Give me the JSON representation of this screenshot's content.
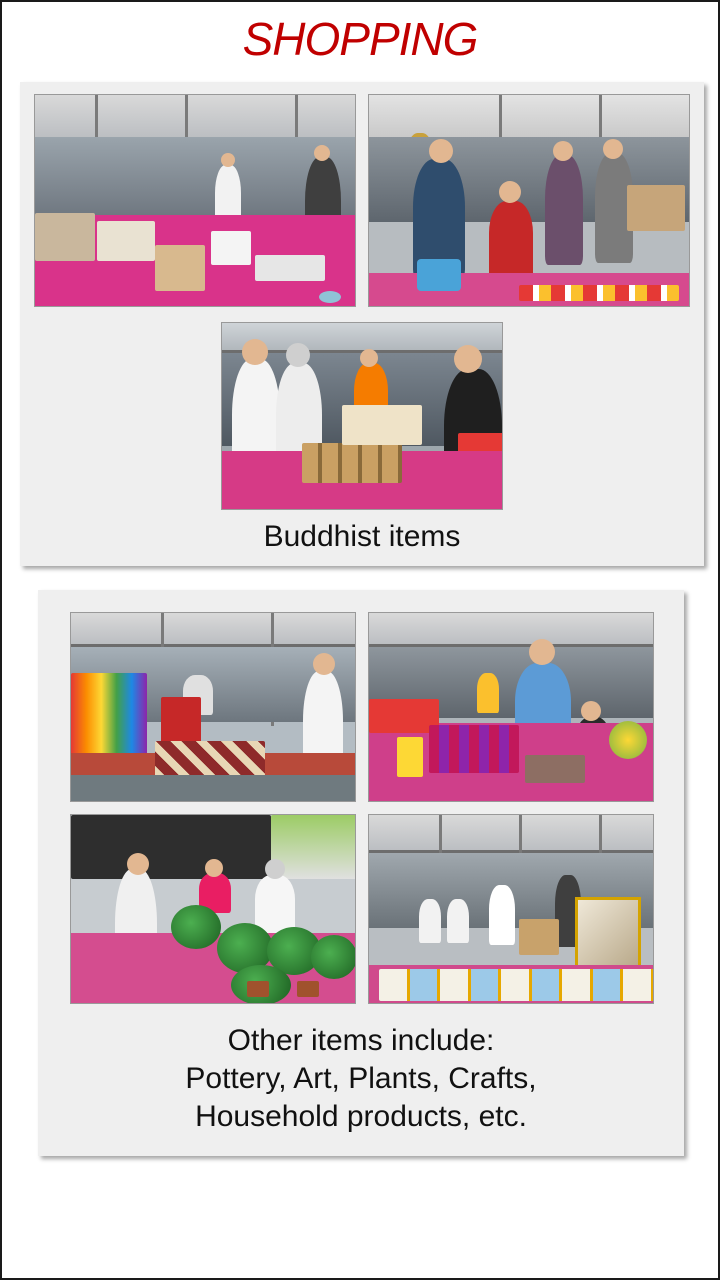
{
  "page": {
    "title": "SHOPPING",
    "title_color": "#c00000"
  },
  "sections": [
    {
      "caption": "Buddhist items",
      "photos": [
        {
          "subject": "stall with cups and boxes on pink tables"
        },
        {
          "subject": "shoppers at stall with ticket box and small items"
        },
        {
          "subject": "shoppers browsing tins and jars"
        }
      ]
    },
    {
      "caption_lines": [
        "Other items include:",
        "Pottery, Art, Plants, Crafts,",
        "Household products, etc."
      ],
      "photos": [
        {
          "subject": "colorful craft textiles stall"
        },
        {
          "subject": "household products and bottles stall"
        },
        {
          "subject": "potted plants stall"
        },
        {
          "subject": "framed art stall"
        }
      ]
    }
  ],
  "colors": {
    "panel_bg": "#efefef",
    "table_pink": "#d9338a",
    "frame_border": "#1a1a1a"
  }
}
